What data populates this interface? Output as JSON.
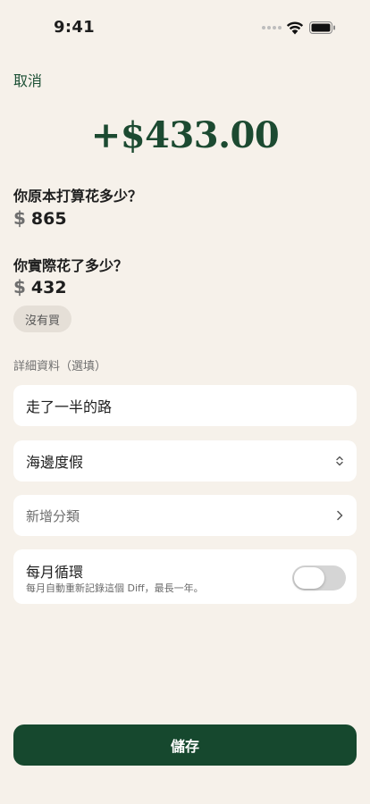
{
  "status_bar": {
    "time": "9:41",
    "icons": [
      "signal-dots-icon",
      "wifi-icon",
      "battery-icon"
    ]
  },
  "header": {
    "cancel_label": "取消"
  },
  "summary": {
    "amount": "+$433.00",
    "accent_color": "#1C4A31"
  },
  "planned": {
    "question": "你原本打算花多少？",
    "currency_symbol": "$",
    "value": "865"
  },
  "actual": {
    "question": "你實際花了多少？",
    "currency_symbol": "$",
    "value": "432",
    "not_bought_label": "沒有買"
  },
  "details": {
    "section_label": "詳細資料（選填）",
    "note_value": "走了一半的路",
    "reason_value": "海邊度假",
    "category_placeholder": "新增分類",
    "recurring": {
      "title": "每月循環",
      "subtitle": "每月自動重新記錄這個 Diff，最長一年。",
      "enabled": false
    }
  },
  "footer": {
    "save_label": "儲存",
    "button_color": "#16482E"
  }
}
